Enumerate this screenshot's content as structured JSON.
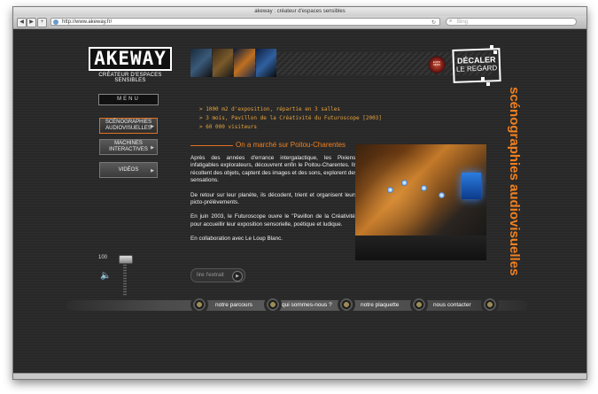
{
  "browser": {
    "title": "akeway : créateur d'espaces sensibles",
    "url": "http://www.akeway.fr/",
    "search_placeholder": "Bing"
  },
  "site": {
    "logo_text": "AKEWAY",
    "logo_subtitle": "CRÉATEUR D'ESPACES SENSIBLES",
    "badge_text": "EXPO SENS",
    "slogan_line1": "DÉCALER",
    "slogan_line2": "LE REGARD",
    "vertical_title": "scénographies audiovisuelles"
  },
  "menu": {
    "label": "MENU",
    "items": [
      {
        "label": "SCÉNOGRAPHIES AUDIOVISUELLES",
        "active": true
      },
      {
        "label": "MACHINES INTERACTIVES",
        "active": false
      },
      {
        "label": "VIDÉOS",
        "active": false
      }
    ]
  },
  "stats": [
    "> 1000 m2 d'exposition, répartie en 3 salles",
    "> 3 mois, Pavillon de la Créativité du Futuroscope [2003]",
    "> 60 000 visiteurs"
  ],
  "section": {
    "title": "On a marché sur Poitou-Charentes"
  },
  "paragraphs": [
    "Après des années d'errance intergalactique, les Pixiens, infatigables explorateurs, découvrent enfin le Poitou-Charentes. Ils récoltent des objets, captent des images et des sons, explorent des sensations.",
    "De retour sur leur planète, ils décodent, trient et organisent leurs picto-prélèvements.",
    "En juin 2003, le Futuroscope ouvre le \"Pavillon de la Créativité\" pour accueillir leur exposition sensorielle, poétique et ludique.",
    "En collaboration avec Le Loup Blanc."
  ],
  "extrait_label": "lire l'extrait",
  "volume": {
    "value": "100"
  },
  "nav": [
    {
      "label": "notre parcours"
    },
    {
      "label": "qui sommes-nous ?"
    },
    {
      "label": "notre plaquette"
    },
    {
      "label": "nous contacter"
    }
  ],
  "colors": {
    "accent": "#f08020",
    "stat": "#e8a23b",
    "background": "#282828"
  }
}
